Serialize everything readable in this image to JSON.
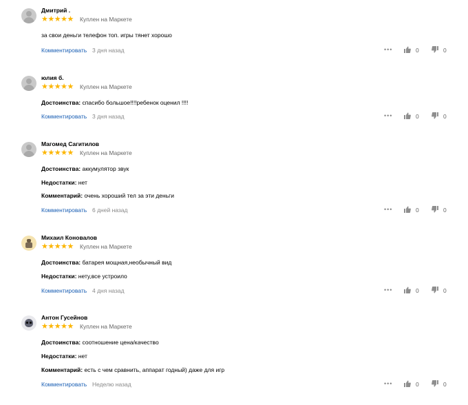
{
  "reviews": [
    {
      "avatar": "gray",
      "name": "Дмитрий .",
      "bought": "Куплен на Маркете",
      "lines": [
        {
          "label": "",
          "text": "за свои деньги телефон топ. игры тянет хорошо"
        }
      ],
      "comment_link": "Комментировать",
      "date": "3 дня назад",
      "likes": "0",
      "dislikes": "0"
    },
    {
      "avatar": "gray",
      "name": "юлия б.",
      "bought": "Куплен на Маркете",
      "lines": [
        {
          "label": "Достоинства:",
          "text": " спасибо большое!!!!ребенок оценил !!!!"
        }
      ],
      "comment_link": "Комментировать",
      "date": "3 дня назад",
      "likes": "0",
      "dislikes": "0"
    },
    {
      "avatar": "gray",
      "name": "Магомед Сагитилов",
      "bought": "Куплен на Маркете",
      "lines": [
        {
          "label": "Достоинства:",
          "text": " аккумулятор звук"
        },
        {
          "label": "Недостатки:",
          "text": " нет"
        },
        {
          "label": "Комментарий:",
          "text": " очень хороший тел за эти деньги"
        }
      ],
      "comment_link": "Комментировать",
      "date": "6 дней назад",
      "likes": "0",
      "dislikes": "0"
    },
    {
      "avatar": "yellow",
      "name": "Михаил Коновалов",
      "bought": "Куплен на Маркете",
      "lines": [
        {
          "label": "Достоинства:",
          "text": " батарея мощная,необычный вид"
        },
        {
          "label": "Недостатки:",
          "text": " нету,все устроило"
        }
      ],
      "comment_link": "Комментировать",
      "date": "4 дня назад",
      "likes": "0",
      "dislikes": "0"
    },
    {
      "avatar": "alien",
      "name": "Антон Гусейнов",
      "bought": "Куплен на Маркете",
      "lines": [
        {
          "label": "Достоинства:",
          "text": " соотношение цена/качество"
        },
        {
          "label": "Недостатки:",
          "text": " нет"
        },
        {
          "label": "Комментарий:",
          "text": " есть с чем сравнить, аппарат годный) даже для игр"
        }
      ],
      "comment_link": "Комментировать",
      "date": "Неделю назад",
      "likes": "0",
      "dislikes": "0"
    }
  ],
  "stars_glyph": "★★★★★",
  "more_glyph": "•••",
  "rating": 5,
  "icons": {
    "more": "more-dots-icon",
    "like": "thumb-up-icon",
    "dislike": "thumb-down-icon"
  },
  "colors": {
    "star": "#fcb500",
    "link": "#1a5fb4",
    "muted": "#888888"
  }
}
